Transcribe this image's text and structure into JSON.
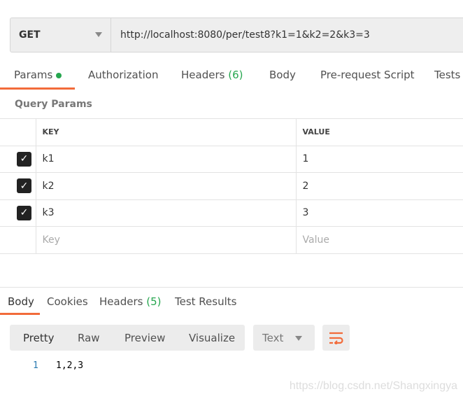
{
  "request": {
    "method": "GET",
    "url": "http://localhost:8080/per/test8?k1=1&k2=2&k3=3"
  },
  "request_tabs": {
    "params": "Params",
    "authorization": "Authorization",
    "headers": "Headers",
    "headers_count": "(6)",
    "body": "Body",
    "prerequest": "Pre-request Script",
    "tests": "Tests"
  },
  "query_params": {
    "title": "Query Params",
    "columns": {
      "key": "KEY",
      "value": "VALUE"
    },
    "rows": [
      {
        "key": "k1",
        "value": "1",
        "checked": true
      },
      {
        "key": "k2",
        "value": "2",
        "checked": true
      },
      {
        "key": "k3",
        "value": "3",
        "checked": true
      }
    ],
    "placeholder": {
      "key": "Key",
      "value": "Value"
    }
  },
  "response_tabs": {
    "body": "Body",
    "cookies": "Cookies",
    "headers": "Headers",
    "headers_count": "(5)",
    "test_results": "Test Results"
  },
  "response_toolbar": {
    "pretty": "Pretty",
    "raw": "Raw",
    "preview": "Preview",
    "visualize": "Visualize",
    "format": "Text"
  },
  "response_body": {
    "line_number": "1",
    "content": "1,2,3"
  },
  "watermark": "https://blog.csdn.net/Shangxingya",
  "colors": {
    "accent": "#f26b3a",
    "count": "#26a64f"
  }
}
